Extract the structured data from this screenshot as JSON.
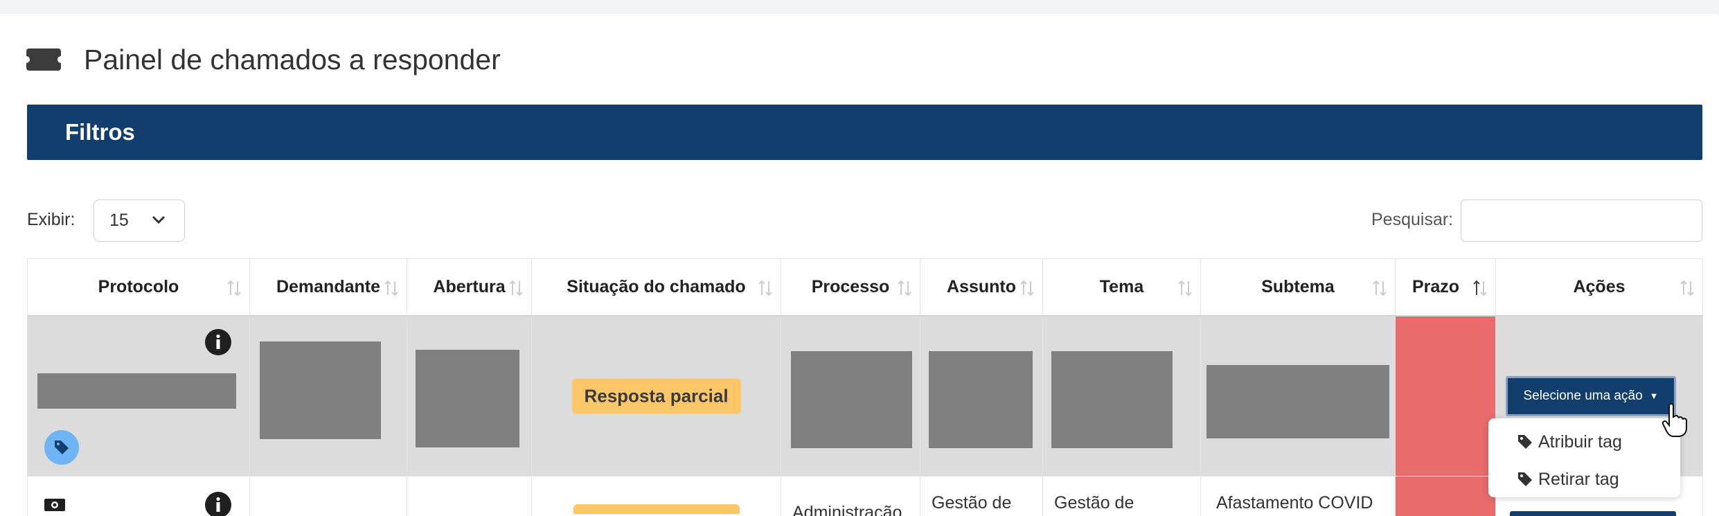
{
  "page": {
    "title": "Painel de chamados a responder",
    "icon": "ticket-icon"
  },
  "filters": {
    "label": "Filtros"
  },
  "length_control": {
    "label": "Exibir:",
    "value": "15"
  },
  "search": {
    "label": "Pesquisar:",
    "value": ""
  },
  "table": {
    "columns": [
      {
        "label": "Protocolo",
        "sort": "none"
      },
      {
        "label": "Demandante",
        "sort": "none"
      },
      {
        "label": "Abertura",
        "sort": "none"
      },
      {
        "label": "Situação do chamado",
        "sort": "none"
      },
      {
        "label": "Processo",
        "sort": "none"
      },
      {
        "label": "Assunto",
        "sort": "none"
      },
      {
        "label": "Tema",
        "sort": "none"
      },
      {
        "label": "Subtema",
        "sort": "none"
      },
      {
        "label": "Prazo",
        "sort": "ascending"
      },
      {
        "label": "Ações",
        "sort": "none"
      }
    ],
    "rows": [
      {
        "status": "Resposta parcial",
        "action_button": "Selecione uma ação"
      },
      {
        "processo": "Administração",
        "assunto": "Gestão de",
        "tema": "Gestão de",
        "subtema": "Afastamento COVID"
      }
    ]
  },
  "action_menu": {
    "items": [
      {
        "label": "Atribuir tag",
        "icon": "tag-icon"
      },
      {
        "label": "Retirar tag",
        "icon": "tag-icon"
      }
    ]
  },
  "colors": {
    "primary": "#123e6d",
    "status_badge": "#fbc769",
    "deadline_overdue": "#e96b6b",
    "tag_circle": "#6fb4f5"
  }
}
